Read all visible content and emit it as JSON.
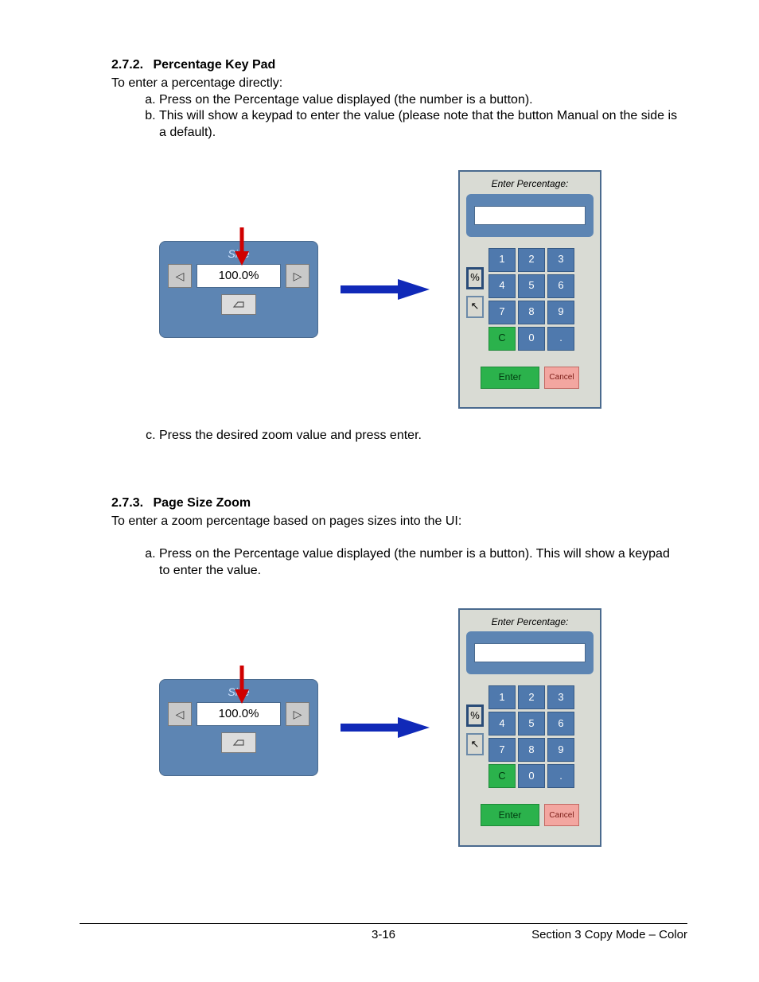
{
  "section272": {
    "heading_num": "2.7.2.",
    "heading_title": "Percentage Key Pad",
    "intro": "To enter a percentage directly:",
    "steps": [
      "Press on the Percentage value displayed (the number is a button).",
      "This will show a keypad to enter the value (please note that the button Manual on the side is a default).",
      "Press the desired zoom value and press enter."
    ]
  },
  "section273": {
    "heading_num": "2.7.3.",
    "heading_title": "Page Size Zoom",
    "intro": "To enter a zoom percentage based on pages sizes into the UI:",
    "steps": [
      "Press on the Percentage value displayed (the number is a button).  This will show a keypad to enter the value."
    ]
  },
  "size_panel": {
    "title": "Size",
    "value": "100.0%",
    "left_glyph": "◁",
    "right_glyph": "▷"
  },
  "keypad": {
    "title": "Enter Percentage:",
    "side": {
      "percent": "%",
      "diag": "↖"
    },
    "keys": {
      "k1": "1",
      "k2": "2",
      "k3": "3",
      "k4": "4",
      "k5": "5",
      "k6": "6",
      "k7": "7",
      "k8": "8",
      "k9": "9",
      "clear": "C",
      "k0": "0",
      "dot": "."
    },
    "enter": "Enter",
    "cancel": "Cancel"
  },
  "footer": {
    "page": "3-16",
    "right": "Section 3    Copy Mode – Color"
  }
}
